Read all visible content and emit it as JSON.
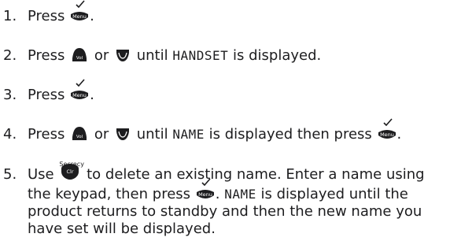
{
  "icons": {
    "menu": "menu-key-icon",
    "vol_up": "vol-up-key-icon",
    "down": "down-key-icon",
    "clear": "clear-secrecy-key-icon"
  },
  "colors": {
    "text": "#1d1d1f",
    "key": "#1d1d1f"
  },
  "keys": {
    "menu_label": "Menu",
    "vol_label": "Vol",
    "clr_label": "Clr",
    "secrecy_label": "Secrecy"
  },
  "steps": [
    {
      "num": "1.",
      "press": "Press",
      "end": "."
    },
    {
      "num": "2.",
      "press": "Press",
      "or": "or",
      "until": "until",
      "display": "HANDSET",
      "tail": "is displayed."
    },
    {
      "num": "3.",
      "press": "Press",
      "end": "."
    },
    {
      "num": "4.",
      "press": "Press",
      "or": "or",
      "until": "until",
      "display": "NAME",
      "tail": "is displayed then press",
      "end": "."
    },
    {
      "num": "5.",
      "use": "Use",
      "delete_text": "to delete an existing name. Enter a name using",
      "line2": "the keypad, then press",
      "line2_end": ".",
      "display": "NAME",
      "line2_tail": "is displayed until the",
      "line3": "product returns to standby and then the new name you",
      "line4": "have set will be displayed."
    }
  ]
}
